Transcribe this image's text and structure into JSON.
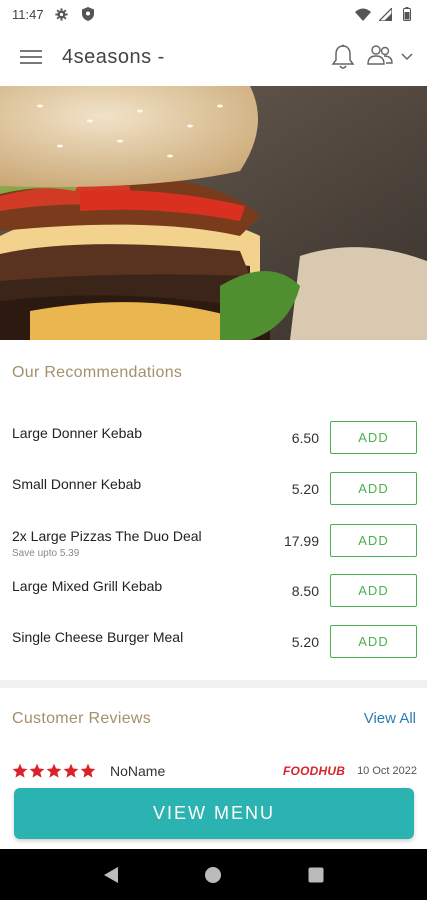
{
  "status_bar": {
    "time": "11:47",
    "icons": [
      "gear-icon",
      "shield-icon",
      "wifi-icon",
      "signal-icon",
      "battery-icon"
    ]
  },
  "app_bar": {
    "title": "4seasons -",
    "icons": [
      "hamburger-menu-icon",
      "bell-icon",
      "users-icon",
      "chevron-down-icon"
    ]
  },
  "hero": {
    "image": "burger-photo"
  },
  "recommendations": {
    "title": "Our Recommendations",
    "add_label": "ADD",
    "items": [
      {
        "name": "Large Donner Kebab",
        "price": "6.50",
        "note": ""
      },
      {
        "name": "Small Donner Kebab",
        "price": "5.20",
        "note": ""
      },
      {
        "name": "2x Large Pizzas The Duo Deal",
        "price": "17.99",
        "note": "Save upto 5.39"
      },
      {
        "name": "Large Mixed Grill Kebab",
        "price": "8.50",
        "note": ""
      },
      {
        "name": "Single Cheese Burger Meal",
        "price": "5.20",
        "note": ""
      }
    ]
  },
  "reviews": {
    "title": "Customer Reviews",
    "view_all": "View All",
    "items": [
      {
        "rating": 5,
        "reviewer": "NoName",
        "source": "FOODHUB",
        "date": "10 Oct 2022"
      }
    ]
  },
  "footer": {
    "view_menu": "VIEW MENU"
  },
  "nav_bar": {
    "icons": [
      "back-icon",
      "home-icon",
      "recents-icon"
    ]
  },
  "colors": {
    "accent_gold": "#a4906b",
    "add_green": "#4caf50",
    "link_blue": "#2b7cb3",
    "star_red": "#d8232a",
    "cta_teal": "#2bb3b1"
  }
}
